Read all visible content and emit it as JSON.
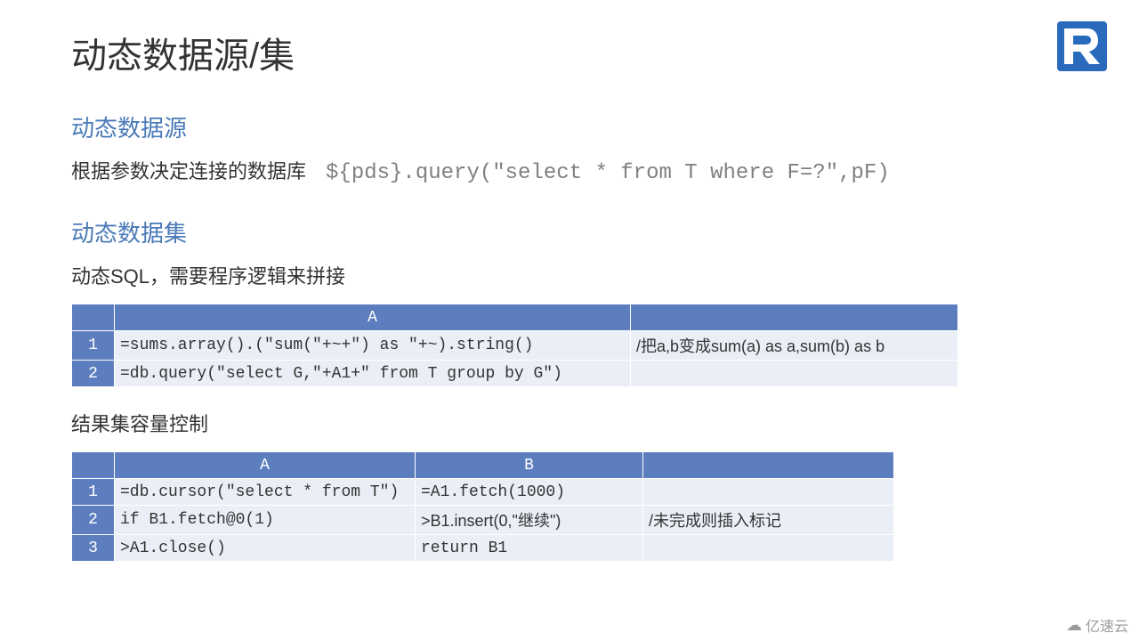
{
  "title": "动态数据源/集",
  "section1": {
    "heading": "动态数据源",
    "desc": "根据参数决定连接的数据库",
    "code": "${pds}.query(\"select * from T where F=?\",pF)"
  },
  "section2": {
    "heading": "动态数据集",
    "desc": "动态SQL，需要程序逻辑来拼接"
  },
  "table1": {
    "headA": "A",
    "r1": {
      "num": "1",
      "a": "=sums.array().(\"sum(\"+~+\") as \"+~).string()",
      "b": "/把a,b变成sum(a) as a,sum(b) as b"
    },
    "r2": {
      "num": "2",
      "a": "=db.query(\"select G,\"+A1+\" from T group by G\")",
      "b": ""
    }
  },
  "section3": {
    "desc": "结果集容量控制"
  },
  "table2": {
    "headA": "A",
    "headB": "B",
    "r1": {
      "num": "1",
      "a": "=db.cursor(\"select * from T\")",
      "b": "=A1.fetch(1000)",
      "c": ""
    },
    "r2": {
      "num": "2",
      "a": "if B1.fetch@0(1)",
      "b": ">B1.insert(0,\"继续\")",
      "c": "/未完成则插入标记"
    },
    "r3": {
      "num": "3",
      "a": ">A1.close()",
      "b": "return B1",
      "c": ""
    }
  },
  "watermark": "亿速云"
}
